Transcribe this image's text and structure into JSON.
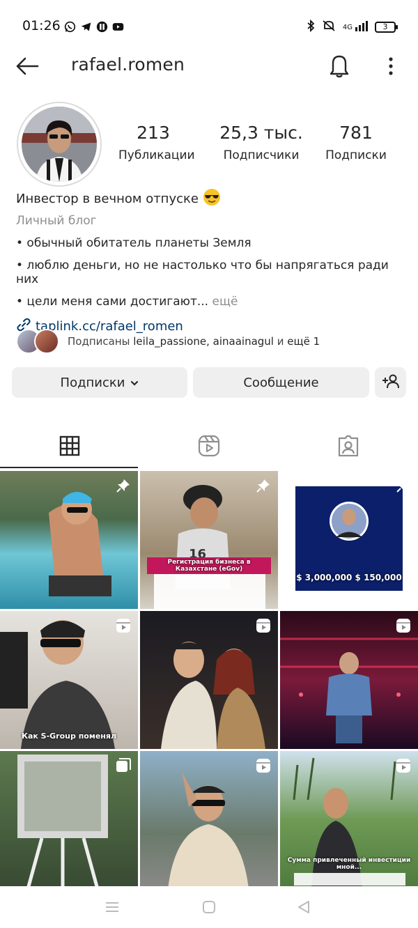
{
  "status_bar": {
    "time": "01:26",
    "app_icons": [
      "whatsapp-icon",
      "telegram-icon",
      "app-icon",
      "youtube-icon"
    ],
    "signal_text": "4G",
    "battery": "3"
  },
  "header": {
    "username": "rafael.romen"
  },
  "stats": {
    "posts_count": "213",
    "posts_label": "Публикации",
    "followers_count": "25,3 тыс.",
    "followers_label": "Подписчики",
    "following_count": "781",
    "following_label": "Подписки"
  },
  "bio": {
    "name": "Инвестор в вечном отпуске",
    "category": "Личный блог",
    "line1": "• обычный обитатель планеты Земля",
    "line2": "• люблю деньги, но не настолько что бы напрягаться ради них",
    "line3": "• цели меня сами достигают...",
    "more": " ещё",
    "link": "taplink.cc/rafael_romen"
  },
  "followed_by": {
    "prefix": "Подписаны ",
    "user1": "leila_passione",
    "sep": ", ",
    "user2": "ainaainagul",
    "and": " и ",
    "rest": "ещё 1"
  },
  "buttons": {
    "following": "Подписки",
    "message": "Сообщение"
  },
  "posts": [
    {
      "type": "pinned",
      "caption": ""
    },
    {
      "type": "pinned",
      "caption": "Регистрация бизнеса в Казахстане (eGov)"
    },
    {
      "type": "pinned",
      "caption": "$ 3,000,000   $ 150,000"
    },
    {
      "type": "reel",
      "caption": "Как S-Group поменял"
    },
    {
      "type": "reel",
      "caption": ""
    },
    {
      "type": "reel",
      "caption": ""
    },
    {
      "type": "carousel",
      "caption": ""
    },
    {
      "type": "reel",
      "caption": ""
    },
    {
      "type": "reel",
      "caption": "Сумма привлеченный инвестиции мной..."
    }
  ],
  "colors": {
    "link": "#00376b",
    "button_bg": "#efefef",
    "muted": "#8e8e8e"
  }
}
